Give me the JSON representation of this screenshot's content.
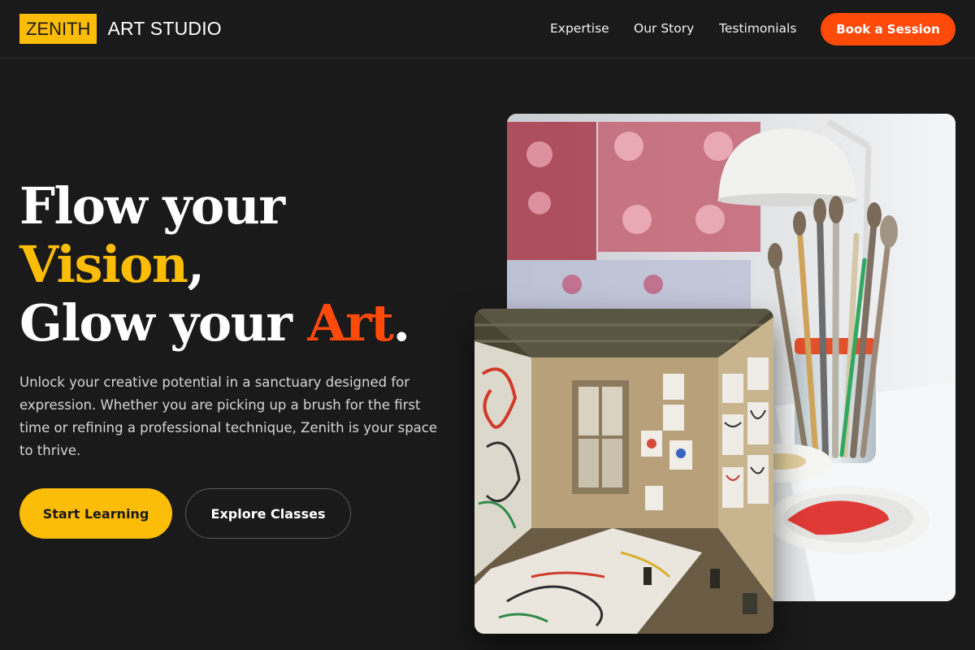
{
  "brand": {
    "logo_box": "ZENITH",
    "logo_text": "ART STUDIO"
  },
  "nav": {
    "items": [
      "Expertise",
      "Our Story",
      "Testimonials"
    ],
    "cta": "Book a Session"
  },
  "hero": {
    "line1": "Flow your",
    "line2_highlight": "Vision",
    "line2_rest": ",",
    "line3_start": "Glow your ",
    "line3_highlight": "Art",
    "line3_rest": ".",
    "description": "Unlock your creative potential in a sanctuary designed for expression. Whether you are picking up a brush for the first time or refining a professional technique, Zenith is your space to thrive.",
    "primary_button": "Start Learning",
    "secondary_button": "Explore Classes"
  },
  "images": {
    "back": "art-supplies-photo",
    "front": "painted-studio-room-photo"
  },
  "colors": {
    "accent_yellow": "#fbbd08",
    "accent_orange": "#ff4a0a",
    "background": "#1a1a1a"
  }
}
